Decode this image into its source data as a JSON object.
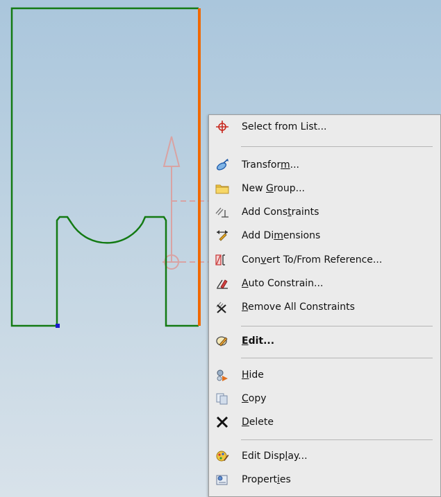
{
  "colors": {
    "sketch_line": "#137a13",
    "selected_edge": "#f06800",
    "reference_geometry": "#d9a3a3",
    "endpoint": "#1a1acc",
    "menu_background": "#ebebeb"
  },
  "context_menu": {
    "items": [
      {
        "pre": "Select from List...",
        "u": "",
        "post": "",
        "icon": "crosshair-icon"
      },
      {
        "pre": "Transfor",
        "u": "m",
        "post": "...",
        "icon": "transform-icon"
      },
      {
        "pre": "New ",
        "u": "G",
        "post": "roup...",
        "icon": "folder-icon"
      },
      {
        "pre": "Add Cons",
        "u": "t",
        "post": "raints",
        "icon": "constraints-icon"
      },
      {
        "pre": "Add Di",
        "u": "m",
        "post": "ensions",
        "icon": "dimension-icon"
      },
      {
        "pre": "Con",
        "u": "v",
        "post": "ert To/From Reference...",
        "icon": "reference-icon"
      },
      {
        "pre": "",
        "u": "A",
        "post": "uto Constrain...",
        "icon": "auto-constrain-icon"
      },
      {
        "pre": "",
        "u": "R",
        "post": "emove All Constraints",
        "icon": "remove-constraints-icon"
      },
      {
        "pre": "",
        "u": "E",
        "post": "dit...",
        "icon": "edit-icon"
      },
      {
        "pre": "",
        "u": "H",
        "post": "ide",
        "icon": "hide-icon"
      },
      {
        "pre": "",
        "u": "C",
        "post": "opy",
        "icon": "copy-icon"
      },
      {
        "pre": "",
        "u": "D",
        "post": "elete",
        "icon": "delete-icon"
      },
      {
        "pre": "Edit Disp",
        "u": "l",
        "post": "ay...",
        "icon": "edit-display-icon"
      },
      {
        "pre": "Propert",
        "u": "i",
        "post": "es",
        "icon": "properties-icon"
      }
    ]
  }
}
